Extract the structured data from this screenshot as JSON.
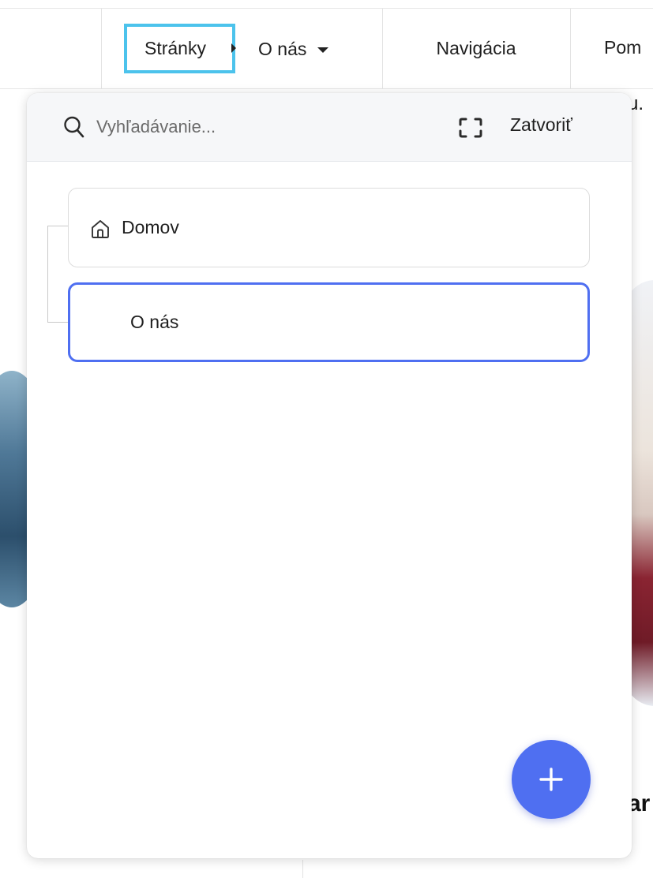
{
  "toolbar": {
    "pages_label": "Stránky",
    "current_page_label": "O nás",
    "navigation_label": "Navigácia",
    "help_label_partial": "Pom"
  },
  "panel": {
    "search_placeholder": "Vyhľadávanie...",
    "close_label": "Zatvoriť",
    "pages": [
      {
        "label": "Domov",
        "icon": "home-icon",
        "selected": false
      },
      {
        "label": "O nás",
        "selected": true
      }
    ],
    "add_button_icon": "plus-icon"
  },
  "background": {
    "text_fragment_top": "u.",
    "text_fragment_bottom": "ar"
  },
  "colors": {
    "accent": "#4f6ff1",
    "focus_outline": "#4cc3ec"
  }
}
